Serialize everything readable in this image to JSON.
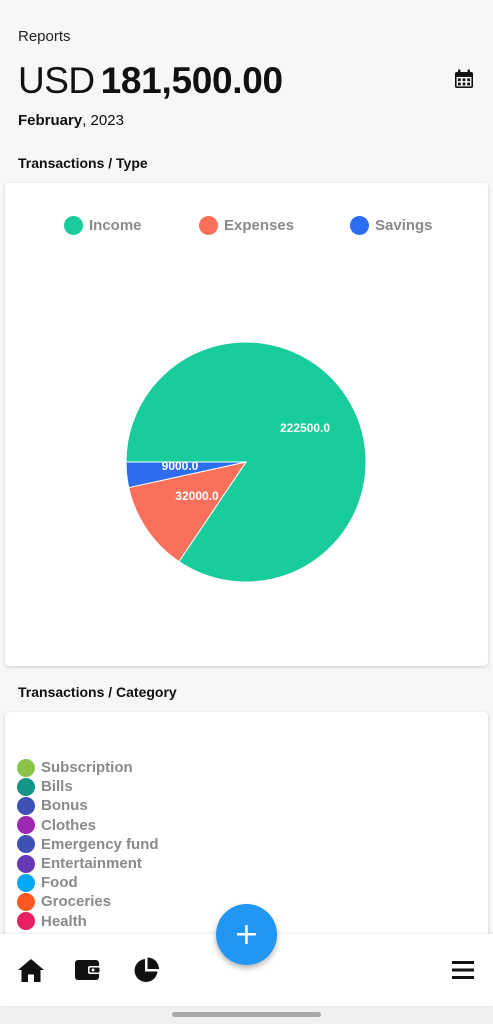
{
  "header": {
    "title": "Reports",
    "currency": "USD",
    "amount": "181,500.00",
    "month": "February",
    "year_suffix": ", 2023"
  },
  "icons": {
    "calendar": "calendar-icon",
    "home": "home-icon",
    "wallet": "wallet-icon",
    "chart": "pie-chart-icon",
    "menu": "menu-icon",
    "add": "plus-icon"
  },
  "sections": {
    "by_type": "Transactions / Type",
    "by_category": "Transactions / Category"
  },
  "chart_data": {
    "type": "pie",
    "categories": [
      "Income",
      "Expenses",
      "Savings"
    ],
    "values": [
      222500.0,
      32000.0,
      9000.0
    ],
    "data_labels": [
      "222500.0",
      "32000.0",
      "9000.0"
    ],
    "colors": [
      "#18cc9c",
      "#fb705a",
      "#2d6ef0"
    ],
    "legend_position": "top"
  },
  "categories": [
    {
      "label": "Subscription",
      "color": "#8bc34a"
    },
    {
      "label": "Bills",
      "color": "#139688"
    },
    {
      "label": "Bonus",
      "color": "#3f51b5"
    },
    {
      "label": "Clothes",
      "color": "#9c27b0"
    },
    {
      "label": "Emergency fund",
      "color": "#3f51b5"
    },
    {
      "label": "Entertainment",
      "color": "#673ab7"
    },
    {
      "label": "Food",
      "color": "#03a9f4"
    },
    {
      "label": "Groceries",
      "color": "#ff5722"
    },
    {
      "label": "Health",
      "color": "#e91e63"
    }
  ],
  "fab": {
    "label": "+"
  }
}
